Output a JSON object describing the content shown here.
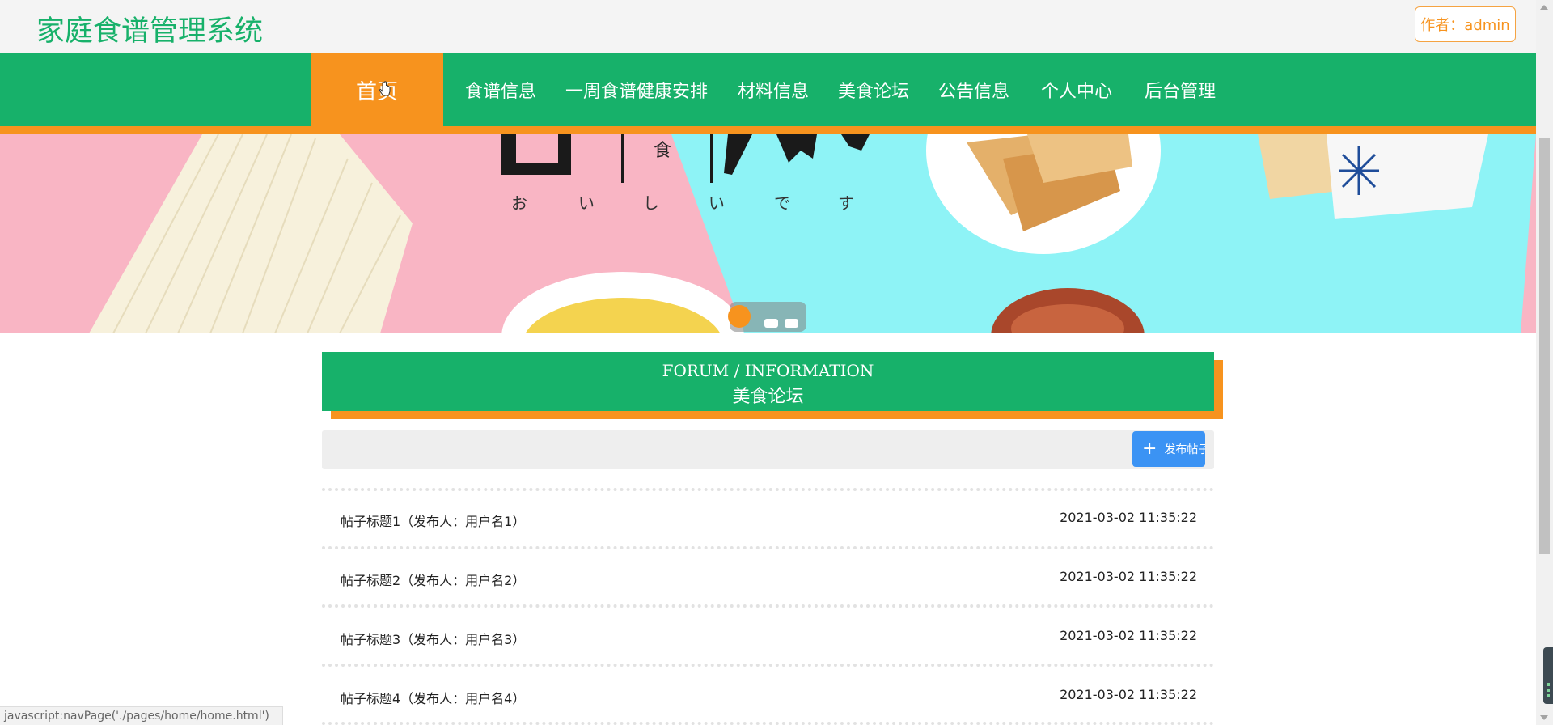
{
  "header": {
    "site_title": "家庭食谱管理系统",
    "author_label": "作者：admin"
  },
  "nav": {
    "items": [
      {
        "label": "首页",
        "active": true
      },
      {
        "label": "食谱信息"
      },
      {
        "label": "一周食谱健康安排"
      },
      {
        "label": "材料信息"
      },
      {
        "label": "美食论坛"
      },
      {
        "label": "公告信息"
      },
      {
        "label": "个人中心"
      },
      {
        "label": "后台管理"
      }
    ]
  },
  "banner": {
    "caption_glyphs": [
      "お",
      "い",
      "し",
      "い",
      "で",
      "す"
    ],
    "title_glyph": "食",
    "carousel_active_index": 0,
    "carousel_count": 3
  },
  "forum": {
    "title_en": "FORUM / INFORMATION",
    "title_cn": "美食论坛",
    "publish_button": "发布帖子",
    "posts": [
      {
        "title": "帖子标题1（发布人：用户名1）",
        "time": "2021-03-02 11:35:22"
      },
      {
        "title": "帖子标题2（发布人：用户名2）",
        "time": "2021-03-02 11:35:22"
      },
      {
        "title": "帖子标题3（发布人：用户名3）",
        "time": "2021-03-02 11:35:22"
      },
      {
        "title": "帖子标题4（发布人：用户名4）",
        "time": "2021-03-02 11:35:22"
      }
    ]
  },
  "status_bar": {
    "url": "javascript:navPage('./pages/home/home.html')"
  },
  "colors": {
    "brand_green": "#17b16a",
    "accent_orange": "#f7931e",
    "button_blue": "#3b93f4"
  }
}
